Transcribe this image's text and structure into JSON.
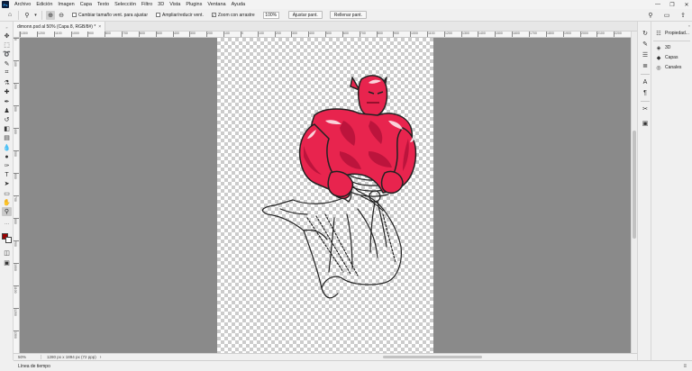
{
  "app": {
    "logo_text": "Ps"
  },
  "menu": {
    "items": [
      "Archivo",
      "Edición",
      "Imagen",
      "Capa",
      "Texto",
      "Selección",
      "Filtro",
      "3D",
      "Vista",
      "Plugins",
      "Ventana",
      "Ayuda"
    ]
  },
  "window_controls": {
    "minimize": "—",
    "restore": "❐",
    "close": "✕"
  },
  "options_bar": {
    "resize_windows_label": "Cambiar tamaño vent. para ajustar",
    "resize_windows_checked": false,
    "zoom_all_label": "Ampliar/reducir vent.",
    "zoom_all_checked": false,
    "scrubby_zoom_label": "Zoom con arrastre",
    "scrubby_zoom_checked": true,
    "zoom_value": "100%",
    "fit_screen_label": "Ajustar pant.",
    "fill_screen_label": "Rellenar pant."
  },
  "document": {
    "tab_title": "dimonn.psd al 50% (Capa 8, RGB/8#) *",
    "close_glyph": "×"
  },
  "rulers": {
    "top_labels": [
      "1300",
      "1200",
      "1100",
      "1000",
      "900",
      "800",
      "700",
      "600",
      "500",
      "400",
      "300",
      "200",
      "100",
      "0",
      "100",
      "200",
      "300",
      "400",
      "500",
      "600",
      "700",
      "800",
      "900",
      "1000",
      "1100",
      "1200",
      "1300",
      "1400",
      "1500",
      "1600",
      "1700",
      "1800",
      "1900",
      "2000",
      "2100",
      "2200"
    ],
    "left_labels": [
      "0",
      "100",
      "200",
      "300",
      "400",
      "500",
      "600",
      "700",
      "800",
      "900",
      "1000",
      "1100",
      "1200",
      "1300"
    ]
  },
  "status_bar": {
    "zoom": "50%",
    "doc_info": "1280 px x 1894 px (72 ppp)",
    "arrow": "›"
  },
  "timeline": {
    "label": "Línea de tiempo",
    "menu_glyph": "≡"
  },
  "right_panel": {
    "items": [
      {
        "icon": "sliders-icon",
        "glyph": "☷",
        "label": "Propiedad..."
      },
      {
        "icon": "cube-icon",
        "glyph": "◈",
        "label": "3D"
      },
      {
        "icon": "layers-icon",
        "glyph": "◆",
        "label": "Capas"
      },
      {
        "icon": "channels-icon",
        "glyph": "◎",
        "label": "Canales"
      }
    ]
  },
  "colors": {
    "foreground": "#9b0000",
    "background": "#ffffff",
    "character_fill": "#e8244e",
    "character_shade": "#b5123a",
    "pasteboard": "#8a8a8a"
  }
}
